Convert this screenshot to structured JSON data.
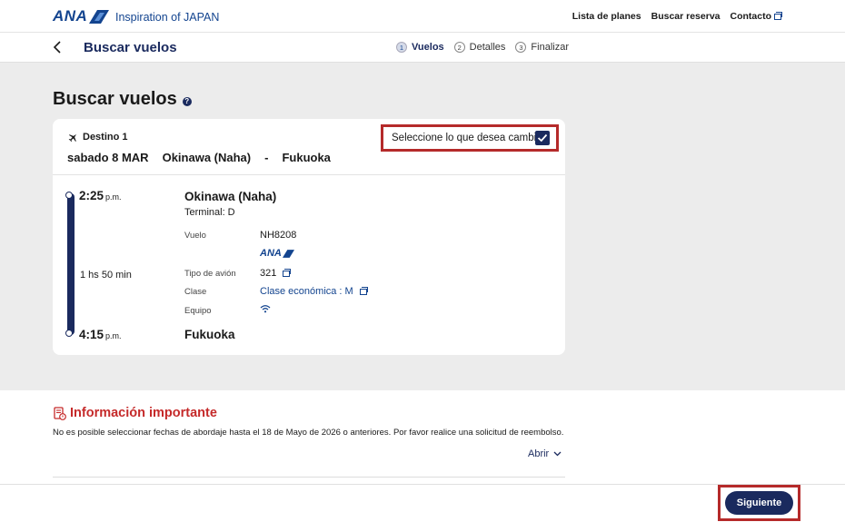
{
  "header": {
    "logo": "ANA",
    "tagline": "Inspiration of JAPAN",
    "nav": [
      "Lista de planes",
      "Buscar reserva",
      "Contacto"
    ]
  },
  "stepbar": {
    "title": "Buscar vuelos",
    "steps": [
      {
        "num": "1",
        "label": "Vuelos",
        "active": true
      },
      {
        "num": "2",
        "label": "Detalles",
        "active": false
      },
      {
        "num": "3",
        "label": "Finalizar",
        "active": false
      }
    ]
  },
  "main": {
    "title": "Buscar vuelos",
    "help": "?",
    "card": {
      "destination_label": "Destino 1",
      "date": "sabado 8 MAR",
      "origin": "Okinawa (Naha)",
      "separator": "-",
      "destination": "Fukuoka",
      "change_label": "Seleccione lo que desea cambiar",
      "change_checked": true,
      "departure_time": "2:25",
      "departure_ampm": "p.m.",
      "duration": "1 hs 50 min",
      "arrival_time": "4:15",
      "arrival_ampm": "p.m.",
      "departure_city": "Okinawa (Naha)",
      "terminal": "Terminal: D",
      "arrival_city": "Fukuoka",
      "details": {
        "flight_label": "Vuelo",
        "flight_value": "NH8208",
        "airline_logo": "ANA",
        "aircraft_label": "Tipo de avión",
        "aircraft_value": "321",
        "class_label": "Clase",
        "class_value": "Clase económica : M",
        "equipment_label": "Equipo",
        "equipment_icon": "wifi-icon"
      }
    }
  },
  "info": {
    "title": "Información importante",
    "text": "No es posible seleccionar fechas de abordaje hasta el 18 de Mayo de 2026 o anteriores. Por favor realice una solicitud de reembolso.",
    "open_label": "Abrir"
  },
  "footer": {
    "next_label": "Siguiente"
  },
  "colors": {
    "brand": "#13448f",
    "navy": "#1a2a5e",
    "alert": "#c52a2a",
    "highlight": "#b52a2a"
  }
}
